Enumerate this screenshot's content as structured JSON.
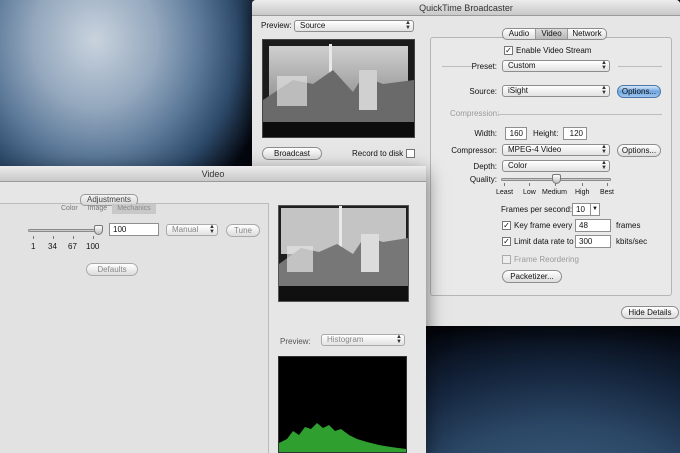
{
  "broadcaster": {
    "title": "QuickTime Broadcaster",
    "preview_label": "Preview:",
    "preview_value": "Source",
    "broadcast_button": "Broadcast",
    "record_label": "Record to disk",
    "tabs": [
      "Audio",
      "Video",
      "Network"
    ],
    "selected_tab": "Video",
    "enable_stream_label": "Enable Video Stream",
    "preset_label": "Preset:",
    "preset_value": "Custom",
    "source_label": "Source:",
    "source_value": "iSight",
    "options_button": "Options...",
    "compression_label": "Compression:",
    "width_label": "Width:",
    "width_value": "160",
    "height_label": "Height:",
    "height_value": "120",
    "compressor_label": "Compressor:",
    "compressor_value": "MPEG-4 Video",
    "depth_label": "Depth:",
    "depth_value": "Color",
    "quality_label": "Quality:",
    "quality_ticks": [
      "Least",
      "Low",
      "Medium",
      "High",
      "Best"
    ],
    "quality_level": 0.5,
    "fps_label": "Frames per second:",
    "fps_value": "10",
    "keyframe_label": "Key frame every",
    "keyframe_value": "48",
    "keyframe_unit": "frames",
    "limit_label": "Limit data rate to",
    "limit_value": "300",
    "limit_unit": "kbits/sec",
    "frame_reorder_label": "Frame Reordering",
    "packetizer_button": "Packetizer...",
    "hide_details_button": "Hide Details"
  },
  "video": {
    "title": "Video",
    "adjustments_label": "Adjustments",
    "subtabs": [
      "Color",
      "Image",
      "Mechanics"
    ],
    "selected_subtab": "Mechanics",
    "slider_ticks": [
      "1",
      "34",
      "67",
      "100"
    ],
    "slider_level": 1.0,
    "value_field": "100",
    "mode_value": "Manual",
    "tune_button": "Tune",
    "defaults_button": "Defaults",
    "preview_label": "Preview:",
    "preview_mode": "Histogram"
  },
  "colors": {
    "histogram": "#2fa02f",
    "accent": "#6fa6e0"
  }
}
